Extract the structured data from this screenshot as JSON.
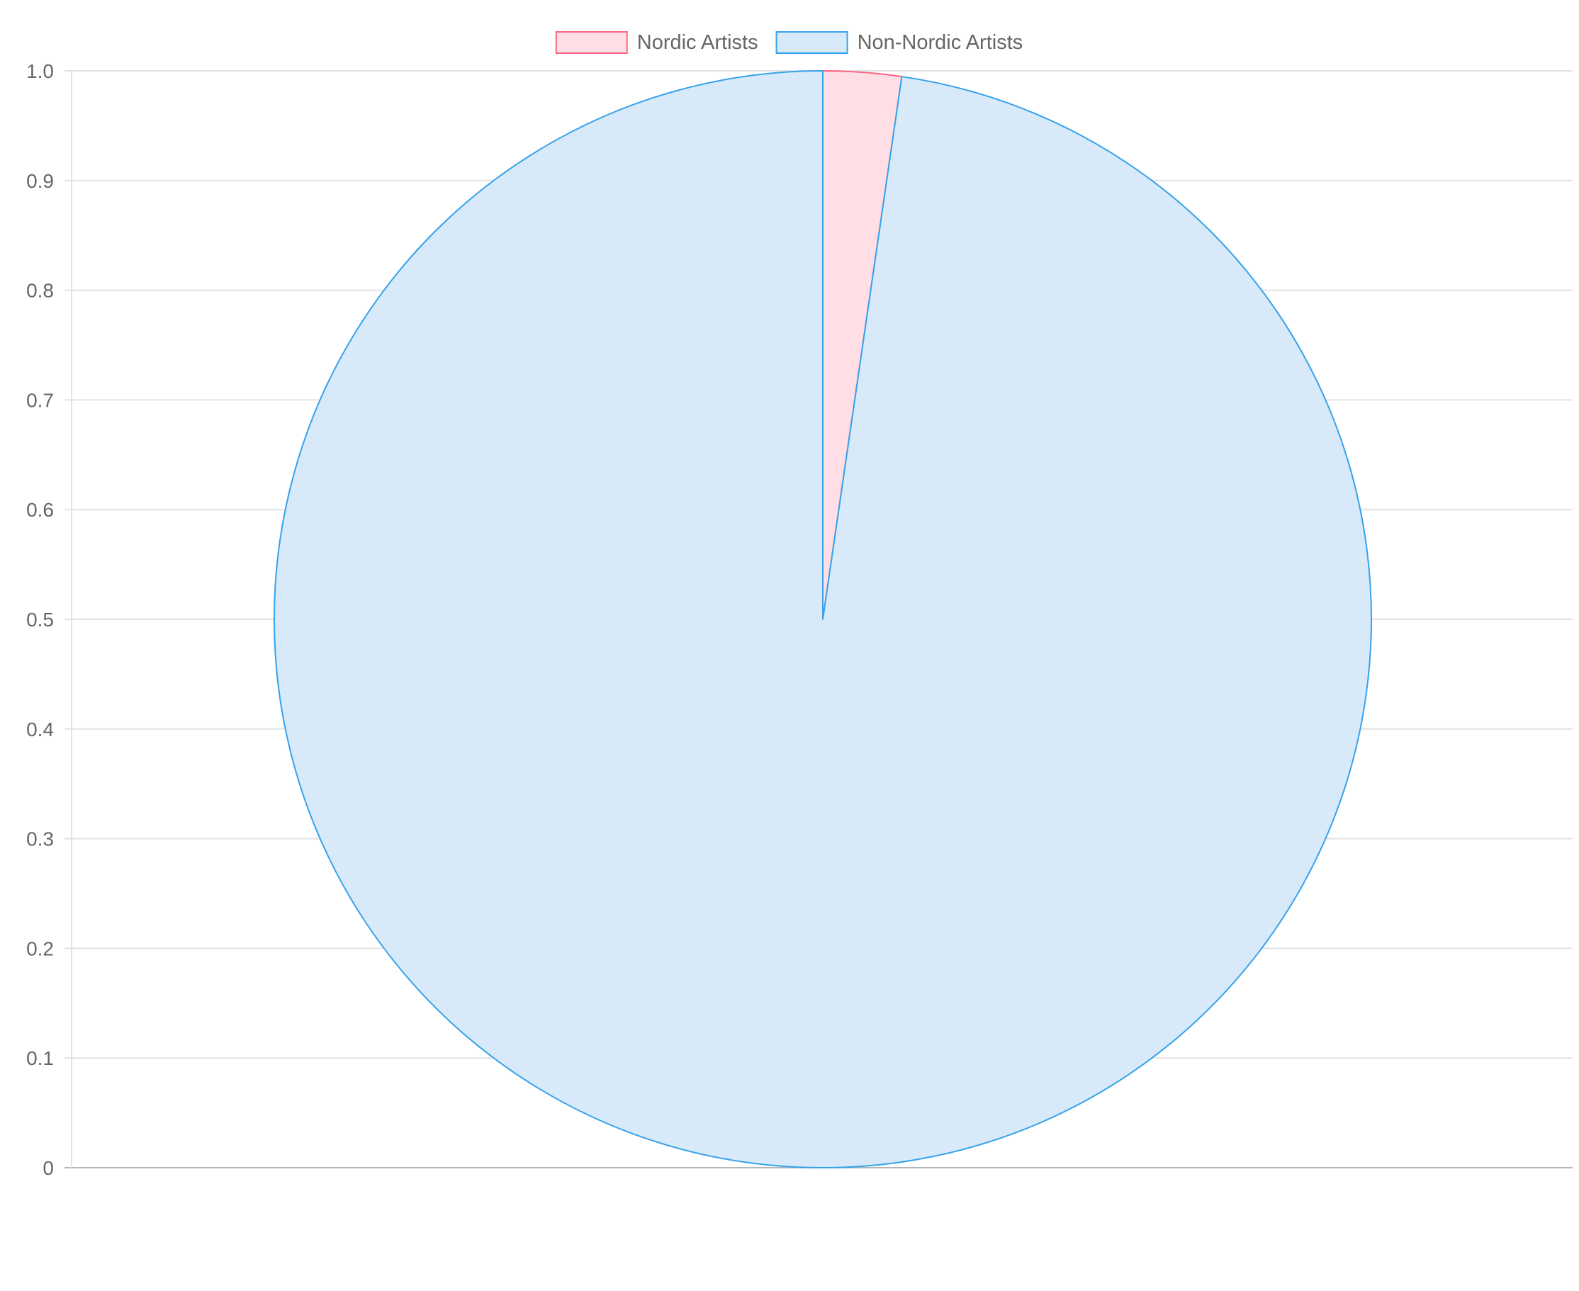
{
  "chart_data": {
    "type": "pie",
    "title": "",
    "xlabel": "",
    "ylabel": "",
    "categories": [
      "Nordic Artists",
      "Non-Nordic Artists"
    ],
    "values": [
      2.3,
      97.7
    ],
    "colors": {
      "Nordic Artists": {
        "fill": "#ffdfe5",
        "stroke": "#ff6384"
      },
      "Non-Nordic Artists": {
        "fill": "#d8eaf9",
        "stroke": "#36a2eb"
      }
    },
    "legend": {
      "position": "top",
      "items": [
        {
          "label": "Nordic Artists"
        },
        {
          "label": "Non-Nordic Artists"
        }
      ]
    },
    "y_axis": {
      "ylim": [
        0,
        1.0
      ],
      "ticks": [
        "1.0",
        "0.9",
        "0.8",
        "0.7",
        "0.6",
        "0.5",
        "0.4",
        "0.3",
        "0.2",
        "0.1",
        "0"
      ]
    },
    "grid": true
  }
}
